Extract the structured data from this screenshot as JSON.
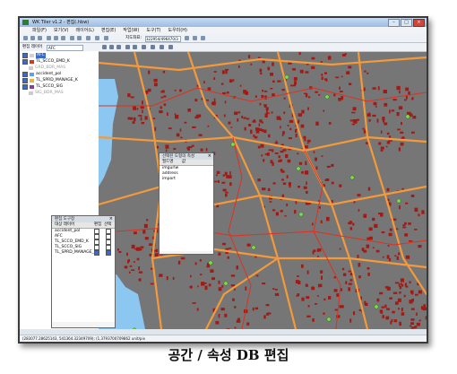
{
  "window": {
    "title": "WK Tiler v1.2 - 편집(.hbw)"
  },
  "menu": [
    "파일(F)",
    "보기(V)",
    "레이어(L)",
    "편집(E)",
    "작업(W)",
    "도구(T)",
    "도우미(H)"
  ],
  "toolbar": {
    "coord_label": "지도좌표:",
    "coord_value": "322954/496470/3"
  },
  "layer_panel": {
    "label": "편집 레이어",
    "selected": "AFC"
  },
  "layers": [
    {
      "name": "AFC",
      "checked": true,
      "color": "#d1d1d1",
      "active": true
    },
    {
      "name": "TL_SCCO_EMD_K",
      "checked": true,
      "color": "#e0301e"
    },
    {
      "name": "GRD_BDR_MAS",
      "checked": false,
      "color": "#cccccc",
      "dim": true
    },
    {
      "name": "accident_pol",
      "checked": true,
      "color": "#5aa3e8"
    },
    {
      "name": "TL_SPRD_MANAGE_K",
      "checked": true,
      "color": "#f0b23b"
    },
    {
      "name": "TL_SCCO_SIG",
      "checked": true,
      "color": "#8a3d9e"
    },
    {
      "name": "SIG_BDR_MAS",
      "checked": false,
      "color": "#cccccc",
      "dim": true
    }
  ],
  "attr_popup": {
    "title": "선택된 도형의 속성",
    "col_field": "필드명",
    "col_value": "값",
    "rows": [
      "imgurlw",
      "address",
      "import"
    ]
  },
  "edit_popup": {
    "title": "편집 도구창",
    "col_layer": "대상 레이어",
    "col_a": "편집",
    "col_b": "선택",
    "rows": [
      "accident_pol",
      "AFC",
      "TL_SCCO_EMD_K",
      "TL_SCCO_SIG",
      "TL_SPRD_MANAGE_K"
    ]
  },
  "statusbar": {
    "text": "(283077.28625143, 541364.32349709); (1,3793700709862 unit/pix"
  },
  "caption": "공간 / 속성 DB 편집",
  "colors": {
    "map_bg": "#767676",
    "parcel": "#a31a14",
    "road": "#f49a3a",
    "boundary": "#e0301e",
    "water": "#8cc7f2",
    "point": "#7ddb4a"
  }
}
